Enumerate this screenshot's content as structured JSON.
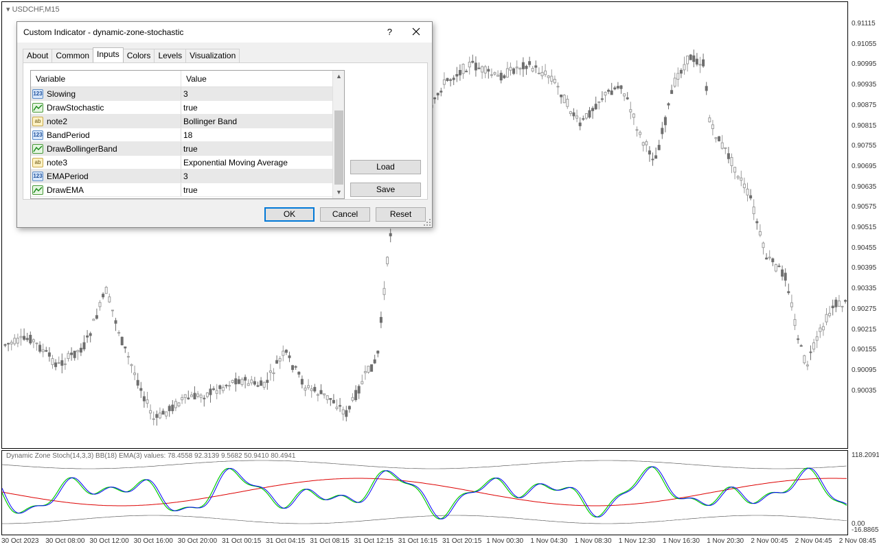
{
  "chart": {
    "symbol": "USDCHF,M15",
    "indicator_label": "Dynamic Zone Stoch(14,3,3) BB(18) EMA(3) values:  78.4558 92.3139 9.5682 50.9410 80.4941",
    "price_ticks": [
      "0.91115",
      "0.91055",
      "0.90995",
      "0.90935",
      "0.90875",
      "0.90815",
      "0.90755",
      "0.90695",
      "0.90635",
      "0.90575",
      "0.90515",
      "0.90455",
      "0.90395",
      "0.90335",
      "0.90275",
      "0.90215",
      "0.90155",
      "0.90095",
      "0.90035"
    ],
    "ind_ticks": [
      "118.2091",
      "0.00",
      "-16.8865"
    ],
    "time_ticks": [
      "30 Oct 2023",
      "30 Oct 08:00",
      "30 Oct 12:00",
      "30 Oct 16:00",
      "30 Oct 20:00",
      "31 Oct 00:15",
      "31 Oct 04:15",
      "31 Oct 08:15",
      "31 Oct 12:15",
      "31 Oct 16:15",
      "31 Oct 20:15",
      "1 Nov 00:30",
      "1 Nov 04:30",
      "1 Nov 08:30",
      "1 Nov 12:30",
      "1 Nov 16:30",
      "1 Nov 20:30",
      "2 Nov 00:45",
      "2 Nov 04:45",
      "2 Nov 08:45"
    ],
    "colors": {
      "candle": "#9a9a9a",
      "candle_bear": "#6e6e6e",
      "stoch": "#00cc00",
      "signal": "#0000ff",
      "ema": "#dd0000",
      "band": "#444444"
    }
  },
  "dialog": {
    "title": "Custom Indicator - dynamic-zone-stochastic",
    "help": "?",
    "tabs": [
      {
        "label": "About",
        "active": false
      },
      {
        "label": "Common",
        "active": false
      },
      {
        "label": "Inputs",
        "active": true
      },
      {
        "label": "Colors",
        "active": false
      },
      {
        "label": "Levels",
        "active": false
      },
      {
        "label": "Visualization",
        "active": false
      }
    ],
    "grid": {
      "col_variable": "Variable",
      "col_value": "Value",
      "rows": [
        {
          "icon": "123",
          "type": "num",
          "variable": "Slowing",
          "value": "3"
        },
        {
          "icon": "bool",
          "type": "bool",
          "variable": "DrawStochastic",
          "value": "true"
        },
        {
          "icon": "ab",
          "type": "str",
          "variable": "note2",
          "value": "Bollinger Band"
        },
        {
          "icon": "123",
          "type": "num",
          "variable": "BandPeriod",
          "value": "18"
        },
        {
          "icon": "bool",
          "type": "bool",
          "variable": "DrawBollingerBand",
          "value": "true"
        },
        {
          "icon": "ab",
          "type": "str",
          "variable": "note3",
          "value": "Exponential Moving Average"
        },
        {
          "icon": "123",
          "type": "num",
          "variable": "EMAPeriod",
          "value": "3"
        },
        {
          "icon": "bool",
          "type": "bool",
          "variable": "DrawEMA",
          "value": "true"
        }
      ]
    },
    "buttons": {
      "load": "Load",
      "save": "Save",
      "ok": "OK",
      "cancel": "Cancel",
      "reset": "Reset"
    }
  }
}
